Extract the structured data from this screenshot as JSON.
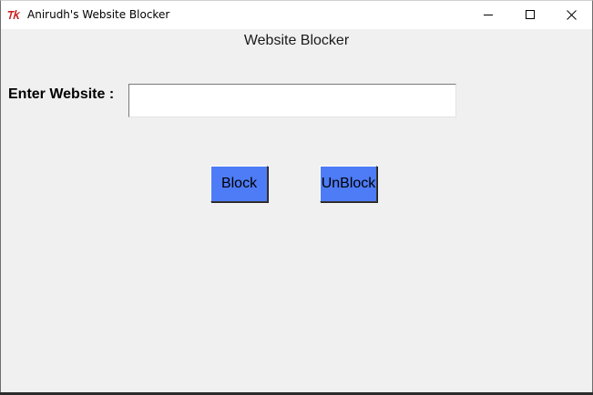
{
  "window": {
    "title": "Anirudh's Website Blocker",
    "app_icon": "tk-feather-icon",
    "controls": {
      "minimize": "minimize-icon",
      "maximize": "maximize-icon",
      "close": "close-icon"
    }
  },
  "main": {
    "heading": "Website Blocker",
    "website_label": "Enter Website :",
    "website_input": {
      "value": "",
      "placeholder": ""
    },
    "block_button": "Block",
    "unblock_button": "UnBlock"
  },
  "colors": {
    "window_bg": "#f0f0f0",
    "button_bg": "#4e7cf7",
    "titlebar_bg": "#ffffff"
  }
}
